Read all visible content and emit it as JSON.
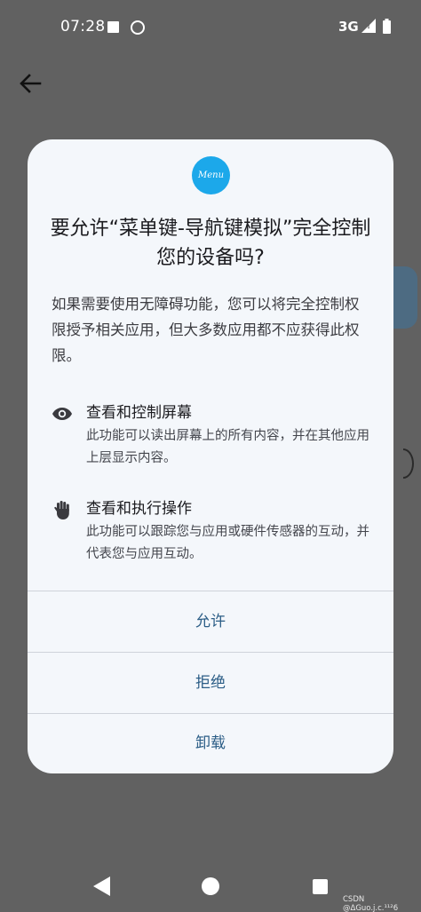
{
  "status_bar": {
    "time": "07:28",
    "network": "3G"
  },
  "app_icon_label": "Menu",
  "dialog": {
    "title": "要允许“菜单键-导航键模拟”完全控制您的设备吗?",
    "description": "如果需要使用无障碍功能，您可以将完全控制权限授予相关应用，但大多数应用都不应获得此权限。",
    "permissions": [
      {
        "icon": "eye-icon",
        "title": "查看和控制屏幕",
        "description": "此功能可以读出屏幕上的所有内容，并在其他应用上层显示内容。"
      },
      {
        "icon": "hand-icon",
        "title": "查看和执行操作",
        "description": "此功能可以跟踪您与应用或硬件传感器的互动，并代表您与应用互动。"
      }
    ],
    "buttons": {
      "allow": "允许",
      "deny": "拒绝",
      "uninstall": "卸载"
    }
  },
  "watermark": "CSDN @ΔGuo.j.c.¹¹²6",
  "colors": {
    "scrim": "#616161",
    "dialog_bg": "#f4f7fb",
    "button_text": "#2b5d86",
    "app_icon": "#1ca8ea"
  }
}
